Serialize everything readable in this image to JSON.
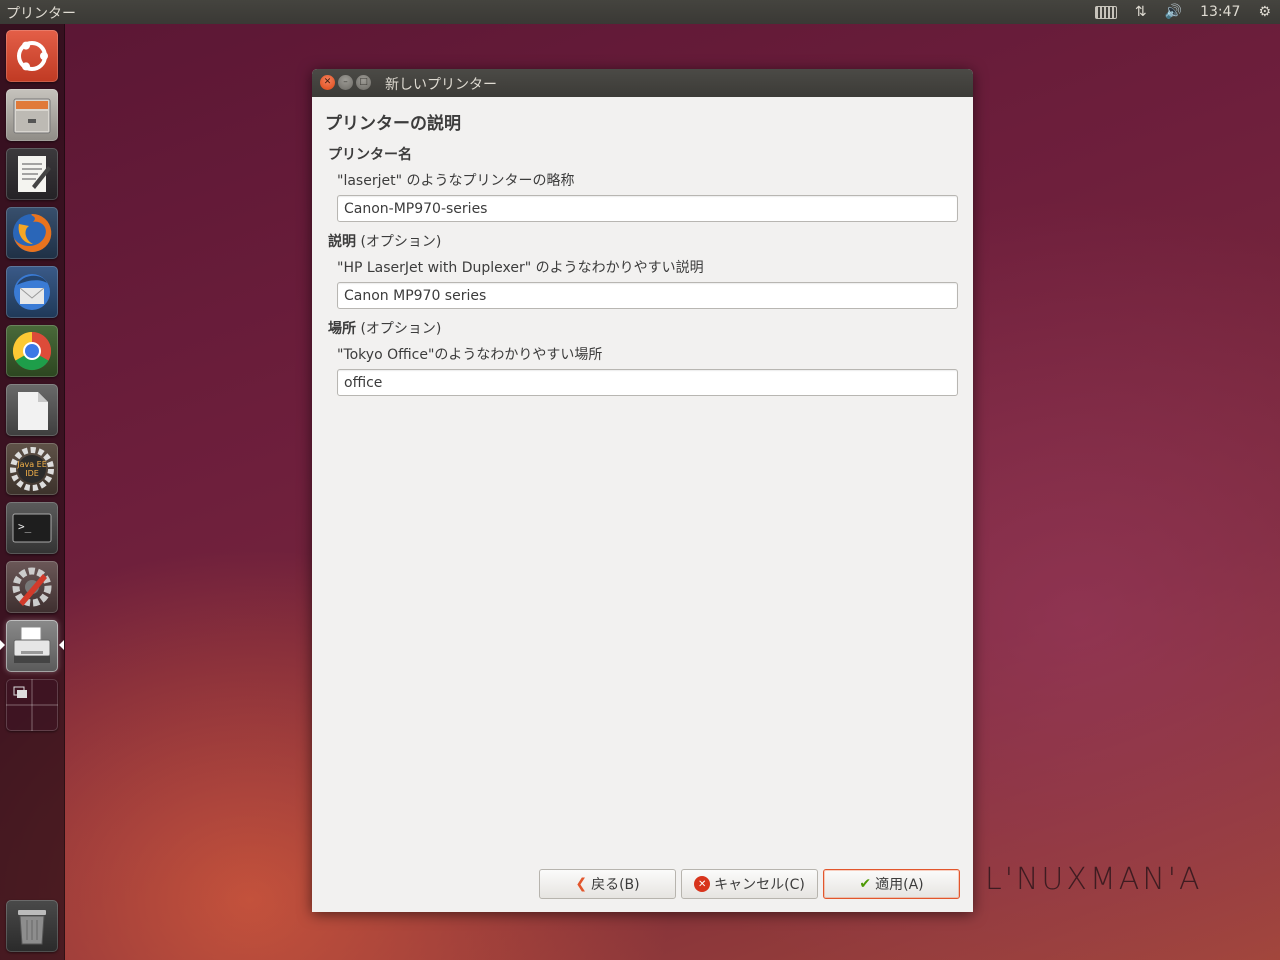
{
  "top_panel": {
    "app_title": "プリンター",
    "clock": "13:47",
    "tray_icons": [
      "keyboard-icon",
      "network-icon",
      "volume-icon",
      "power-gear-icon"
    ]
  },
  "launcher": {
    "items": [
      {
        "name": "dash-icon"
      },
      {
        "name": "files-icon"
      },
      {
        "name": "text-editor-icon"
      },
      {
        "name": "firefox-icon"
      },
      {
        "name": "thunderbird-icon"
      },
      {
        "name": "chrome-icon"
      },
      {
        "name": "libreoffice-icon"
      },
      {
        "name": "eclipse-java-ee-icon",
        "label": "Java EE IDE"
      },
      {
        "name": "terminal-icon"
      },
      {
        "name": "system-settings-icon"
      },
      {
        "name": "printer-icon",
        "active": true
      },
      {
        "name": "workspace-switcher-icon"
      },
      {
        "name": "trash-icon"
      }
    ]
  },
  "dialog": {
    "title": "新しいプリンター",
    "heading": "プリンターの説明",
    "sections": [
      {
        "label": "プリンター名",
        "optional": "",
        "hint": "\"laserjet\" のようなプリンターの略称",
        "value": "Canon-MP970-series"
      },
      {
        "label": "説明",
        "optional": "(オプション)",
        "hint": "\"HP LaserJet with Duplexer\" のようなわかりやすい説明",
        "value": "Canon MP970 series"
      },
      {
        "label": "場所",
        "optional": "(オプション)",
        "hint": "\"Tokyo Office\"のようなわかりやすい場所",
        "value": "office"
      }
    ],
    "buttons": {
      "back": "戻る(B)",
      "cancel": "キャンセル(C)",
      "apply": "適用(A)"
    },
    "accent_color": "#e2562c"
  },
  "watermark": "L'NUXMAN'A"
}
